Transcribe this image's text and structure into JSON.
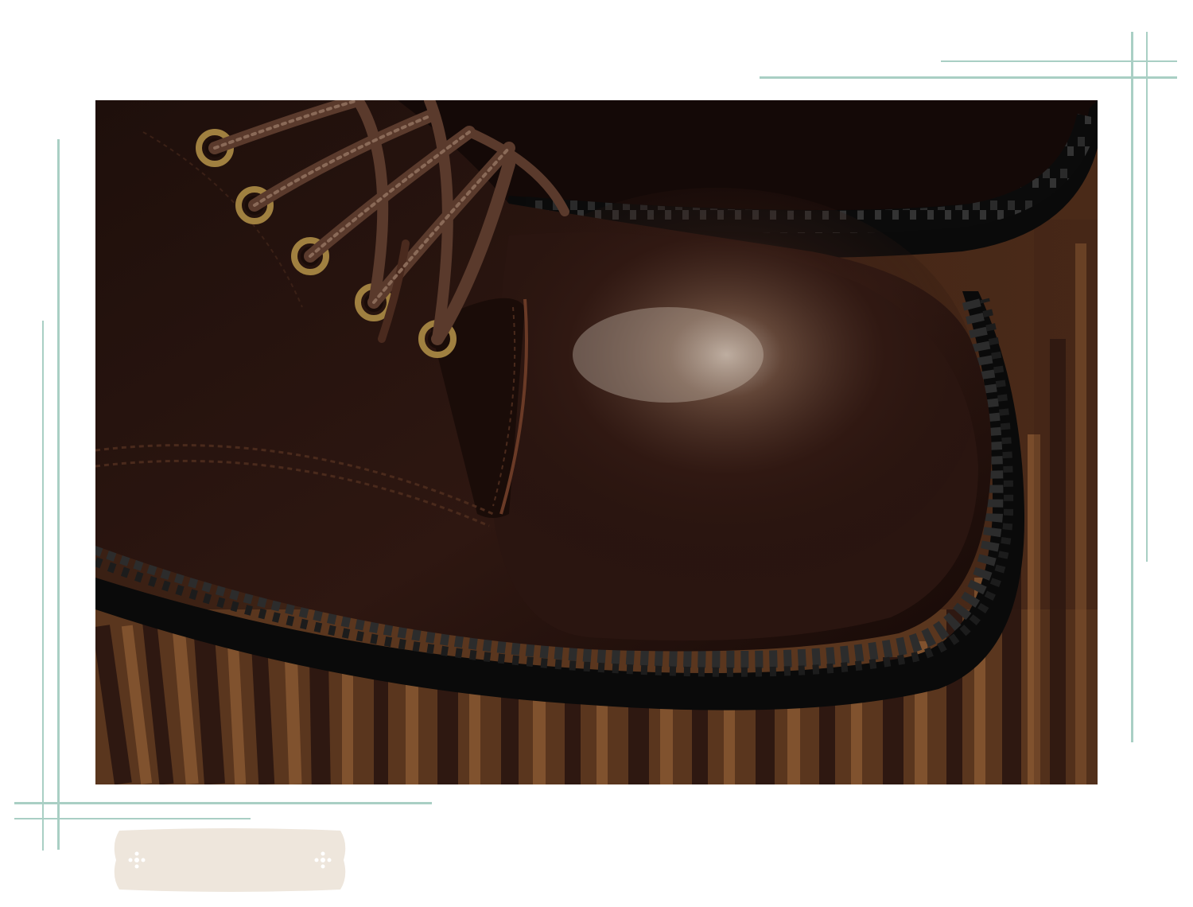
{
  "frame": {
    "line_color": "#a9cfc4",
    "banner_color": "#eee6dc",
    "banner_ornament_color": "#ffffff"
  },
  "photo": {
    "subject": "shoe",
    "leather_color": "#2a1510",
    "sole_color": "#0d0d0d",
    "lace_color": "#5a3a2c",
    "eyelet_color": "#a08040",
    "wood_light": "#8a5a34",
    "wood_dark": "#2a1610"
  }
}
